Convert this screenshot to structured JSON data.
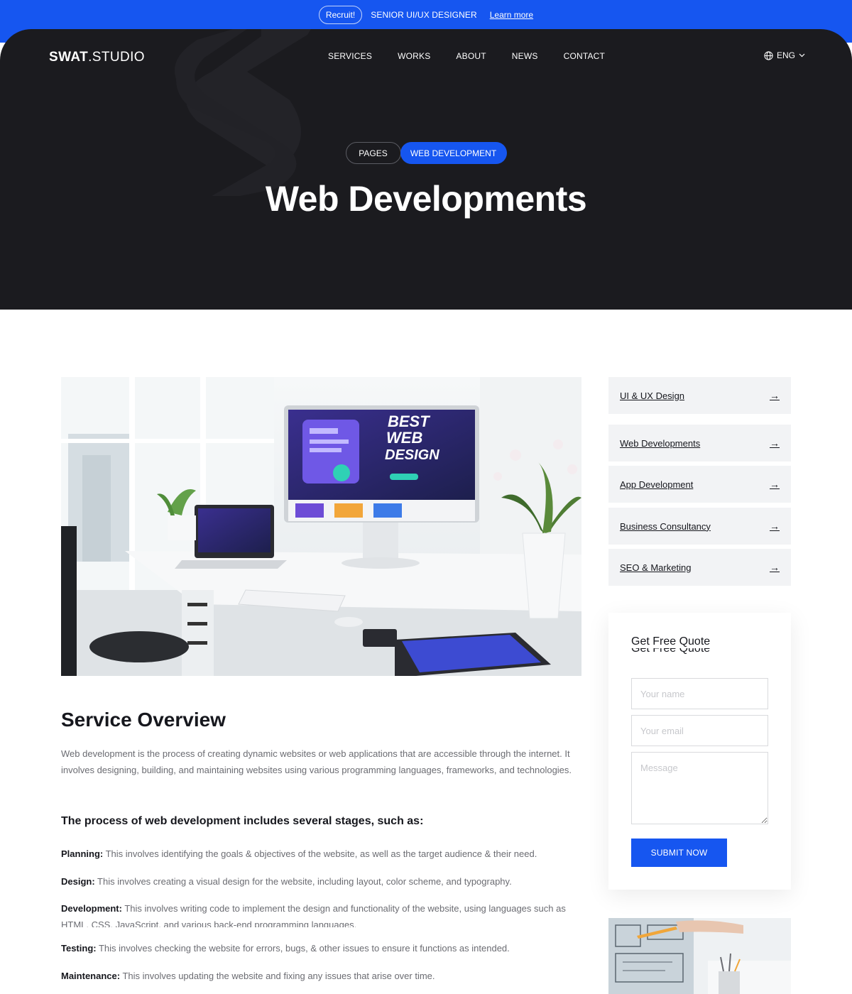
{
  "announcement": {
    "badge": "Recruit!",
    "role": "SENIOR UI/UX DESIGNER",
    "link": "Learn more"
  },
  "header": {
    "logo_bold": "SWAT",
    "logo_rest": ".STUDIO",
    "nav": [
      "SERVICES",
      "WORKS",
      "ABOUT",
      "NEWS",
      "CONTACT"
    ],
    "language": "ENG"
  },
  "hero": {
    "breadcrumb": [
      "PAGES",
      "WEB DEVELOPMENT"
    ],
    "title": "Web Developments"
  },
  "main_image": {
    "screen_text": [
      "BEST",
      "WEB",
      "DESIGN"
    ]
  },
  "overview": {
    "title": "Service Overview",
    "text": "Web development is the process of creating dynamic websites or web applications that are accessible through the internet. It involves designing, building, and maintaining websites using various programming languages, frameworks, and technologies."
  },
  "process": {
    "title": "The process of web development includes several stages, such as:",
    "stages": [
      {
        "label": "Planning:",
        "text": " This involves identifying the goals & objectives of the website, as well as the target audience & their need."
      },
      {
        "label": "Design:",
        "text": " This involves creating a visual design for the website, including layout, color scheme, and typography."
      },
      {
        "label": "Development:",
        "text": " This involves writing code to implement the design and functionality of the website, using languages such as HTML, CSS, JavaScript, and various back-end programming languages."
      },
      {
        "label": "Testing:",
        "text": " This involves checking the website for errors, bugs, & other issues to ensure it functions as intended."
      },
      {
        "label": "Maintenance:",
        "text": " This involves updating the website and fixing any issues that arise over time."
      }
    ]
  },
  "sidebar": {
    "services": [
      "UI & UX Design",
      "Web Developments",
      "App Development",
      "Business Consultancy",
      "SEO & Marketing"
    ],
    "arrow_icon": "arrow-right-icon"
  },
  "quote": {
    "title": "Get Free Quote",
    "name_placeholder": "Your name",
    "email_placeholder": "Your email",
    "message_placeholder": "Message",
    "submit": "SUBMIT NOW"
  },
  "colors": {
    "accent": "#1656f0",
    "hero_bg": "#1b1b1f",
    "service_bg": "#f2f3f5",
    "body_text": "#6b6c72"
  }
}
